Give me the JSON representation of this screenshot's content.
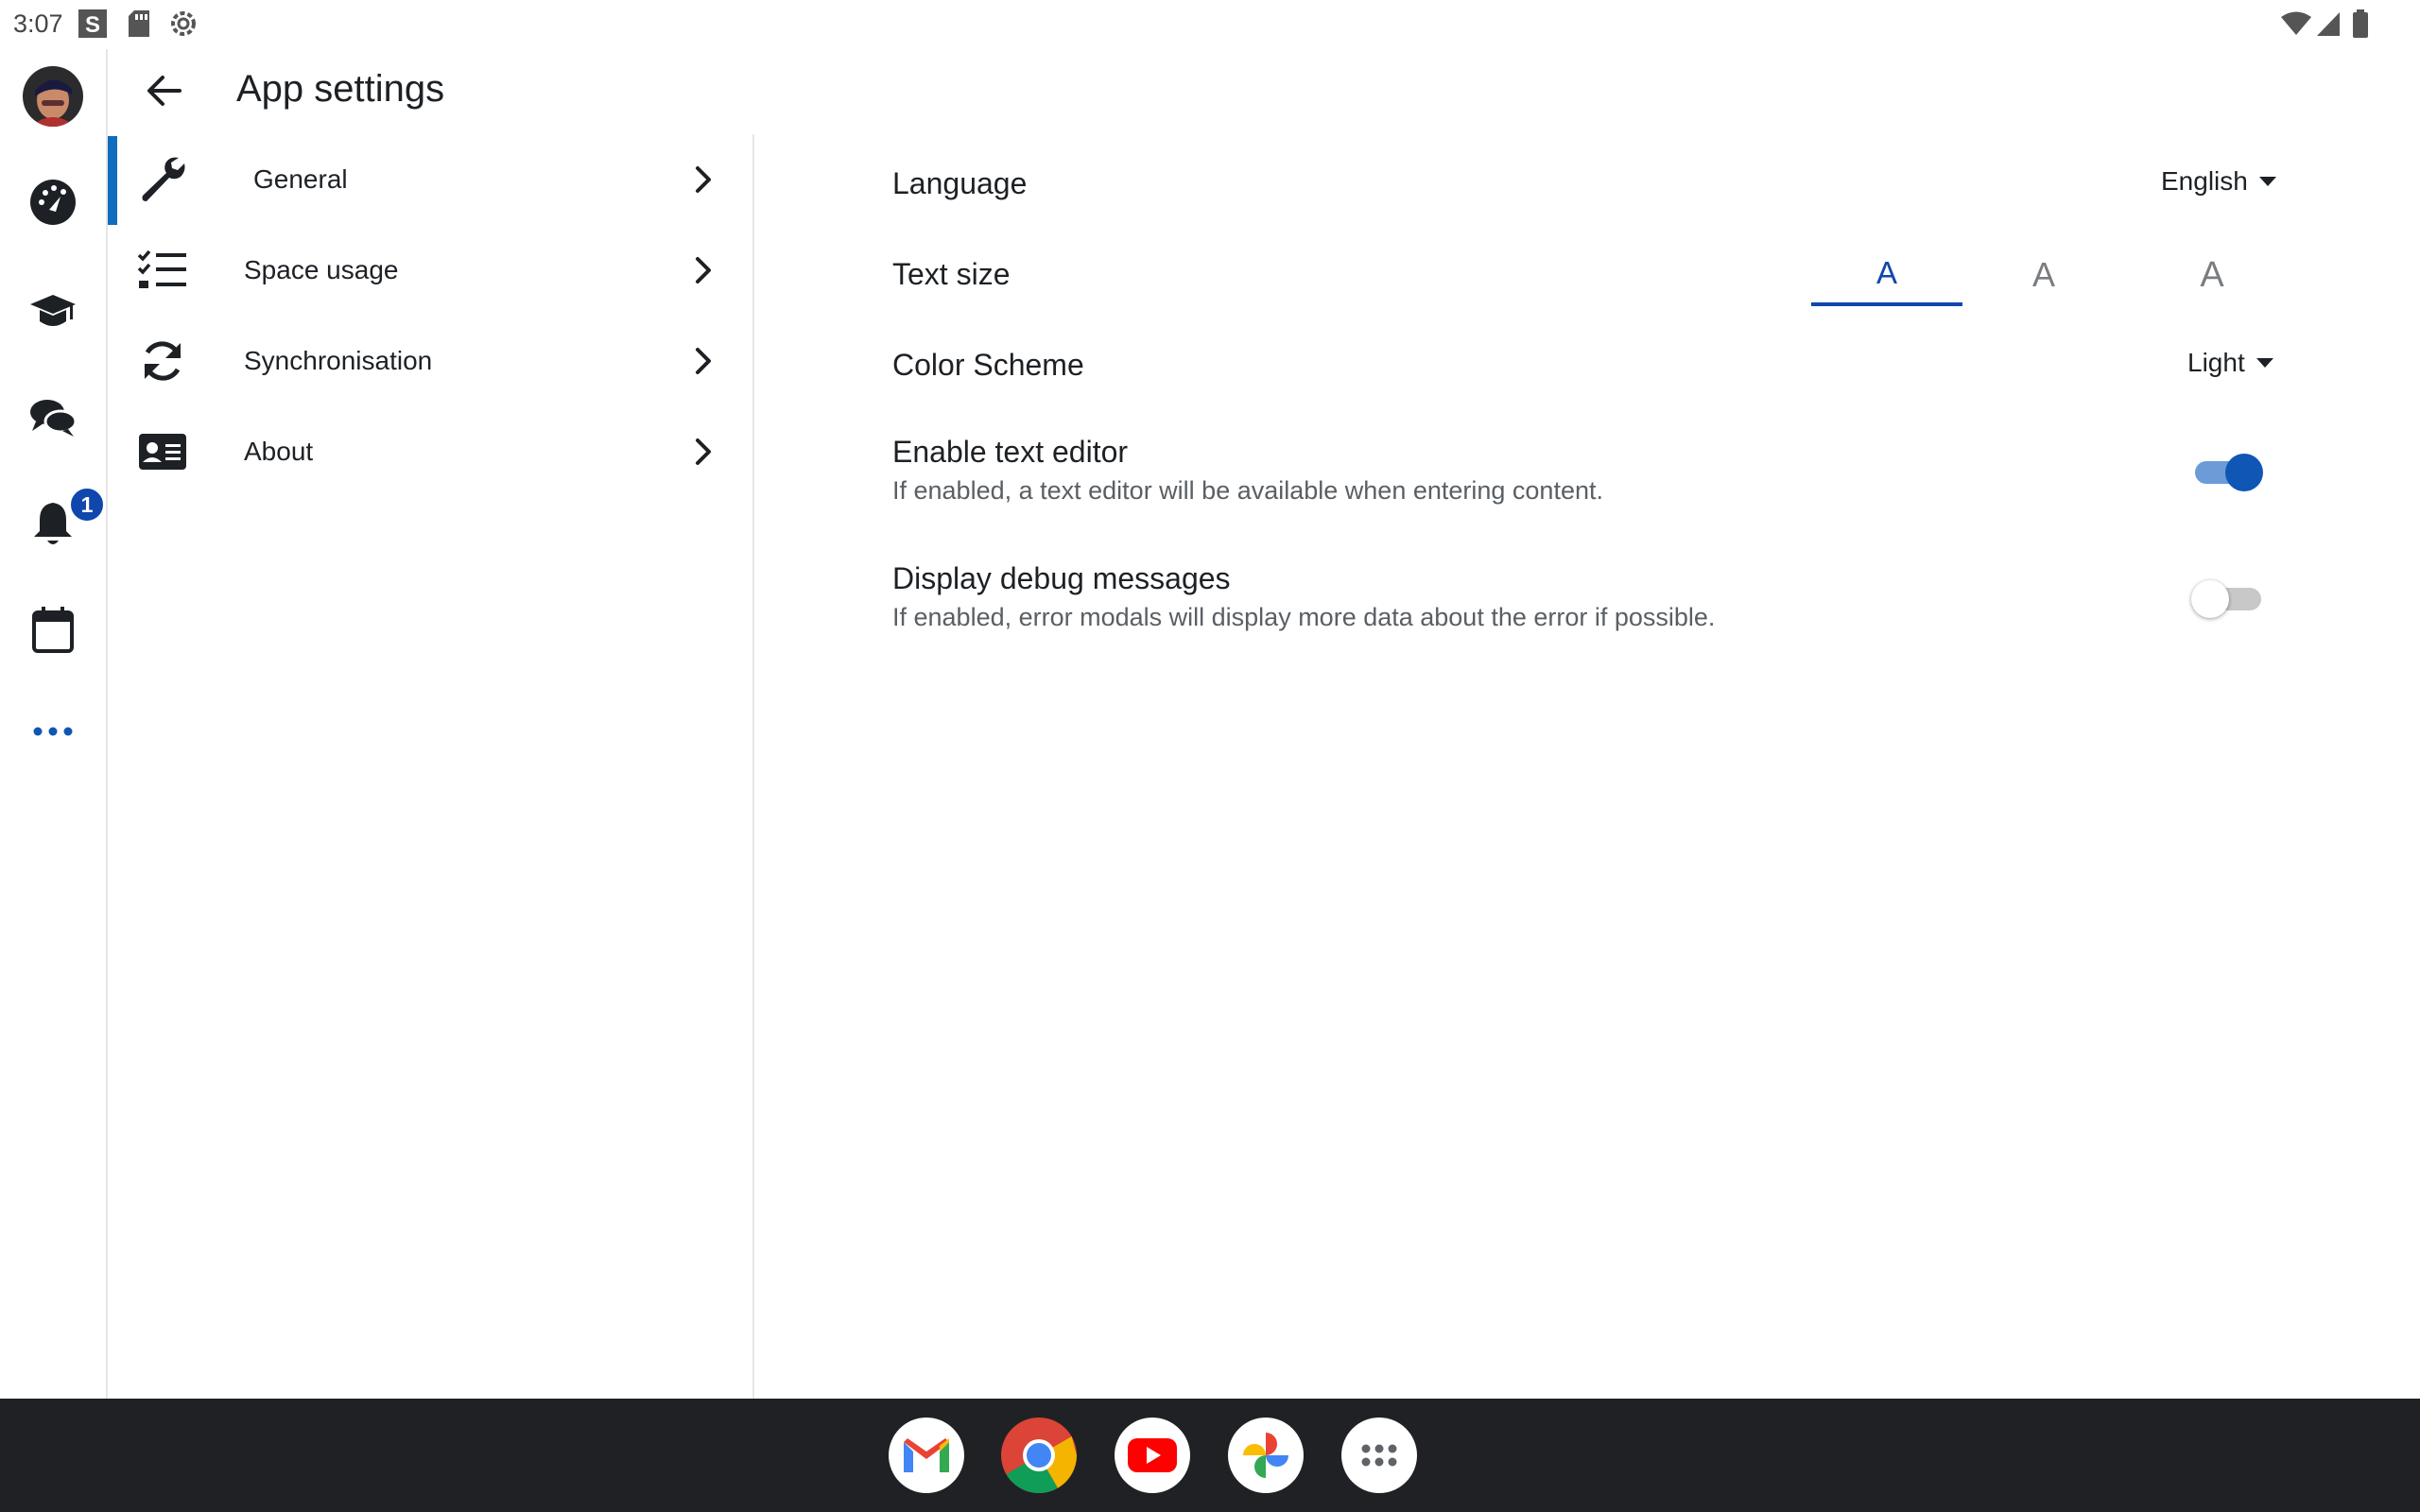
{
  "status_bar": {
    "time": "3:07",
    "left_icons": [
      "s-app-icon",
      "sd-card-icon",
      "settings-gear-icon"
    ],
    "right_icons": [
      "wifi-icon",
      "cell-signal-icon",
      "battery-icon"
    ]
  },
  "nav_rail": {
    "items": [
      {
        "name": "avatar",
        "icon": "user-avatar"
      },
      {
        "name": "dashboard",
        "icon": "dashboard-icon"
      },
      {
        "name": "courses",
        "icon": "graduation-cap-icon"
      },
      {
        "name": "messages",
        "icon": "chat-bubbles-icon"
      },
      {
        "name": "notifications",
        "icon": "bell-icon",
        "badge": "1"
      },
      {
        "name": "calendar",
        "icon": "calendar-icon"
      },
      {
        "name": "more",
        "icon": "more-dots-icon"
      }
    ],
    "accent_color": "#0f47ad"
  },
  "header": {
    "title": "App settings",
    "back_icon": "arrow-left-icon"
  },
  "side_menu": {
    "items": [
      {
        "label": "General",
        "icon": "wrench-icon",
        "active": true
      },
      {
        "label": "Space usage",
        "icon": "checklist-icon",
        "active": false
      },
      {
        "label": "Synchronisation",
        "icon": "sync-icon",
        "active": false
      },
      {
        "label": "About",
        "icon": "id-card-icon",
        "active": false
      }
    ]
  },
  "settings": {
    "language": {
      "label": "Language",
      "value": "English"
    },
    "text_size": {
      "label": "Text size",
      "options": [
        "A",
        "A",
        "A"
      ],
      "selected_index": 0
    },
    "color_scheme": {
      "label": "Color Scheme",
      "value": "Light"
    },
    "text_editor": {
      "label": "Enable text editor",
      "description": "If enabled, a text editor will be available when entering content.",
      "enabled": true
    },
    "debug_messages": {
      "label": "Display debug messages",
      "description": "If enabled, error modals will display more data about the error if possible.",
      "enabled": false
    }
  },
  "dock": {
    "apps": [
      "gmail-icon",
      "chrome-icon",
      "youtube-icon",
      "photos-icon",
      "app-drawer-icon"
    ]
  }
}
